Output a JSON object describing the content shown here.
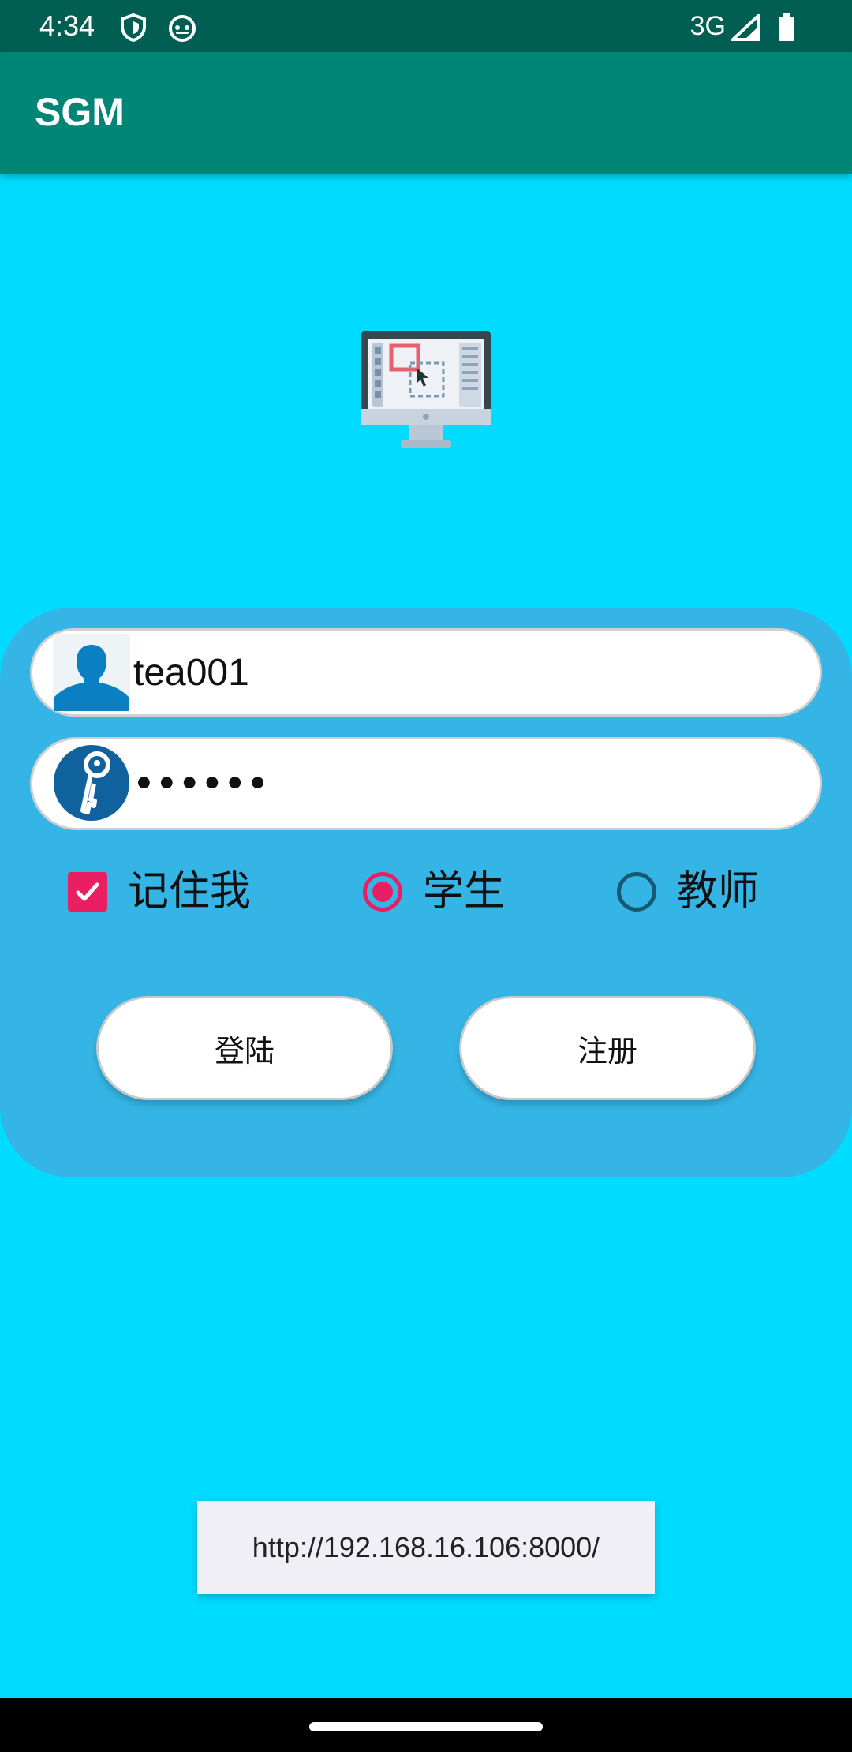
{
  "status_bar": {
    "time": "4:34",
    "network": "3G",
    "icons": [
      "shield-icon",
      "android-icon",
      "signal-icon",
      "battery-icon"
    ]
  },
  "app_bar": {
    "title": "SGM"
  },
  "hero": {
    "icon": "monitor-icon"
  },
  "login_form": {
    "username": {
      "icon": "user-icon",
      "value": "tea001"
    },
    "password": {
      "icon": "key-icon",
      "value": "••••••"
    },
    "remember_me": {
      "label": "记住我",
      "checked": true
    },
    "roles": [
      {
        "label": "学生",
        "selected": true
      },
      {
        "label": "教师",
        "selected": false
      }
    ],
    "buttons": {
      "login": "登陆",
      "register": "注册"
    }
  },
  "toast": {
    "text": "http://192.168.16.106:8000/"
  },
  "colors": {
    "status_bar": "#005f52",
    "app_bar": "#008577",
    "page_background": "#00dcff",
    "card": "#35b5e5",
    "accent": "#e91e63",
    "radio_off": "#165a72"
  }
}
